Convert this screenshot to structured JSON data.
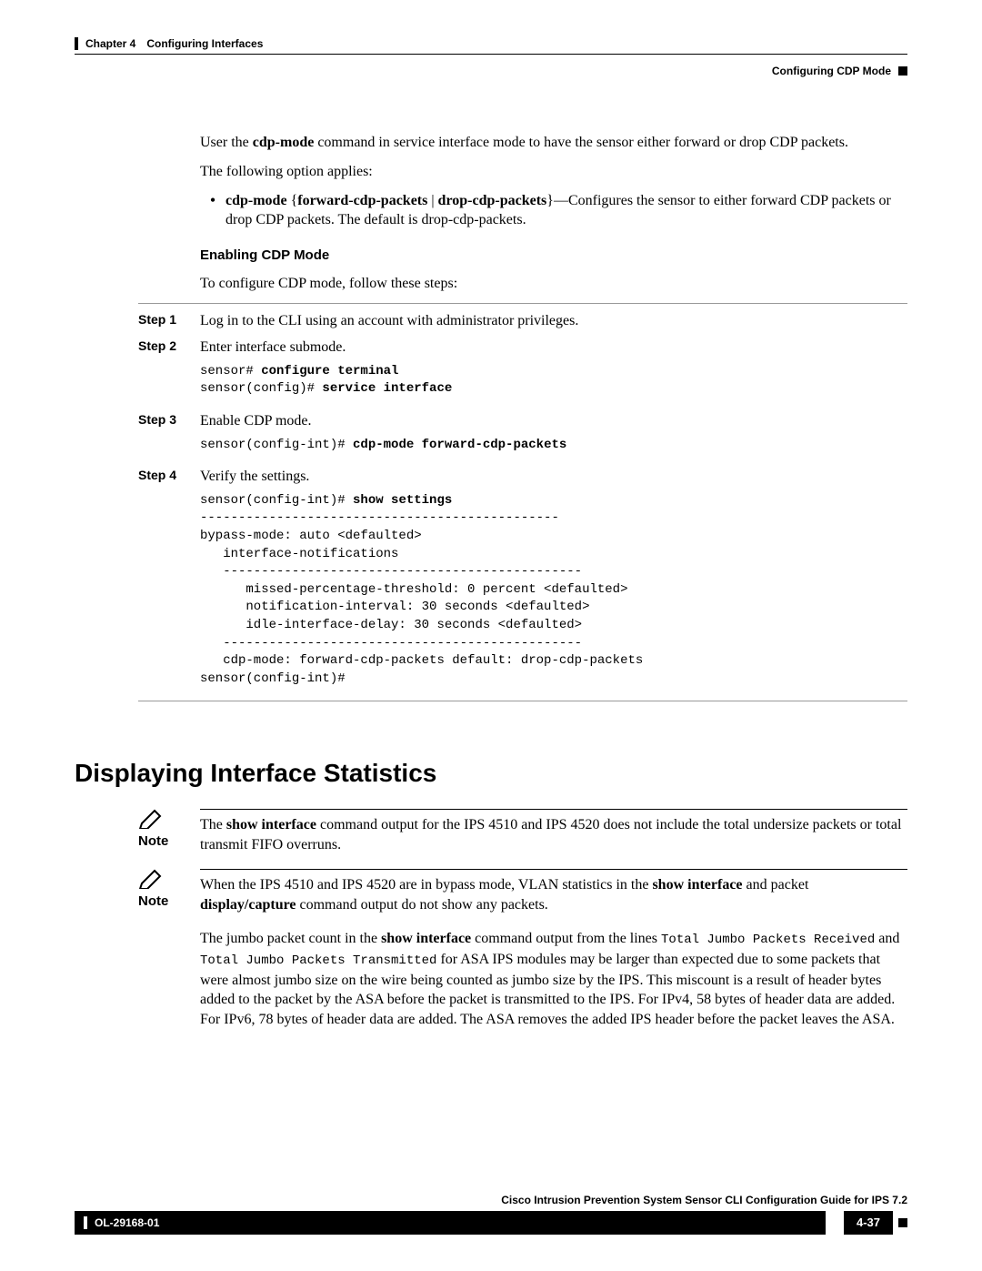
{
  "header": {
    "chapter_num": "Chapter 4",
    "chapter_title": "Configuring Interfaces",
    "section_right": "Configuring CDP Mode"
  },
  "intro": {
    "p1_pre": "User the ",
    "p1_cmd": "cdp-mode",
    "p1_post": " command in service interface mode to have the sensor either forward or drop CDP packets.",
    "p2": "The following option applies:",
    "bullet_cmd": "cdp-mode",
    "bullet_brace_open": " {",
    "bullet_opt1": "forward-cdp-packets",
    "bullet_pipe": " | ",
    "bullet_opt2": "drop-cdp-packets",
    "bullet_brace_close": "}",
    "bullet_post": "—Configures the sensor to either forward CDP packets or drop CDP packets. The default is drop-cdp-packets."
  },
  "enable": {
    "heading": "Enabling CDP Mode",
    "lead": "To configure CDP mode, follow these steps:"
  },
  "steps": {
    "s1_label": "Step 1",
    "s1_text": "Log in to the CLI using an account with administrator privileges.",
    "s2_label": "Step 2",
    "s2_text": "Enter interface submode.",
    "s2_code_prefix1": "sensor# ",
    "s2_code_bold1": "configure terminal",
    "s2_code_prefix2": "sensor(config)# ",
    "s2_code_bold2": "service interface",
    "s3_label": "Step 3",
    "s3_text": "Enable CDP mode.",
    "s3_code_prefix": "sensor(config-int)# ",
    "s3_code_bold": "cdp-mode forward-cdp-packets",
    "s4_label": "Step 4",
    "s4_text": "Verify the settings.",
    "s4_code_prefix": "sensor(config-int)# ",
    "s4_code_bold": "show settings",
    "s4_code_rest": "\n-----------------------------------------------\nbypass-mode: auto <defaulted>\n   interface-notifications\n   -----------------------------------------------\n      missed-percentage-threshold: 0 percent <defaulted>\n      notification-interval: 30 seconds <defaulted>\n      idle-interface-delay: 30 seconds <defaulted>\n   -----------------------------------------------\n   cdp-mode: forward-cdp-packets default: drop-cdp-packets\nsensor(config-int)#"
  },
  "section2": {
    "title": "Displaying Interface Statistics",
    "note_label": "Note",
    "note1_pre": "The ",
    "note1_cmd": "show interface",
    "note1_post": " command output for the IPS 4510 and IPS 4520 does not include the total undersize packets or total transmit FIFO overruns.",
    "note2_pre": "When the IPS 4510 and IPS 4520 are in bypass mode, VLAN statistics in the ",
    "note2_cmd1": "show interface",
    "note2_mid": " and packet ",
    "note2_cmd2": "display/capture",
    "note2_post": " command output do not show any packets.",
    "jumbo_pre": "The jumbo packet count in the ",
    "jumbo_cmd": "show interface",
    "jumbo_mid1": " command output from the lines ",
    "jumbo_mono1": "Total Jumbo Packets Received",
    "jumbo_and": " and ",
    "jumbo_mono2": "Total Jumbo Packets Transmitted",
    "jumbo_post": " for ASA IPS modules may be larger than expected due to some packets that were almost jumbo size on the wire being counted as jumbo size by the IPS. This miscount is a result of header bytes added to the packet by the ASA before the packet is transmitted to the IPS. For IPv4, 58 bytes of header data are added. For IPv6, 78 bytes of header data are added. The ASA removes the added IPS header before the packet leaves the ASA."
  },
  "footer": {
    "book_title": "Cisco Intrusion Prevention System Sensor CLI Configuration Guide for IPS 7.2",
    "docnum": "OL-29168-01",
    "pagenum": "4-37"
  }
}
